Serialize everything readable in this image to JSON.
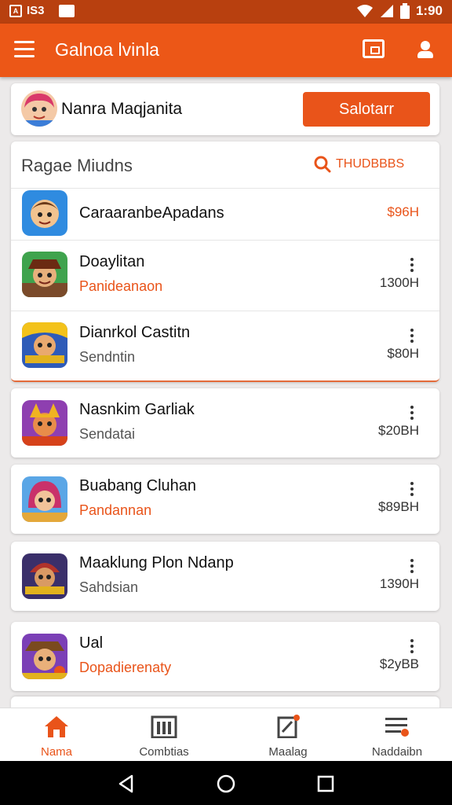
{
  "status_bar": {
    "left_label": "IS3",
    "time": "1:90"
  },
  "app_bar": {
    "title": "Galnoa lvinla"
  },
  "profile": {
    "name": "Nanra Maqjanita",
    "select_label": "Salotarr"
  },
  "list": {
    "title": "Ragae Miudns",
    "search_label": "THUDBBBS",
    "items": [
      {
        "name": "CaraaranbeApadans",
        "sub": "",
        "price": "$96H",
        "icon": "ninja-game-icon"
      },
      {
        "name": "Doaylitan",
        "sub": "Panideanaon",
        "price": "1300H",
        "icon": "pirate-game-icon"
      },
      {
        "name": "Dianrkol Castitn",
        "sub": "Sendntin",
        "price": "$80H",
        "icon": "warrior-game-icon"
      }
    ]
  },
  "cards": [
    {
      "name": "Nasnkim Garliak",
      "sub": "Sendatai",
      "price": "$20BH",
      "icon": "viking-game-icon"
    },
    {
      "name": "Buabang Cluhan",
      "sub": "Pandannan",
      "price": "$89BH",
      "icon": "mage-game-icon"
    },
    {
      "name": "Maaklung Plon Ndanp",
      "sub": "Sahdsian",
      "price": "1390H",
      "icon": "knight-game-icon"
    },
    {
      "name": "Ual",
      "sub": "Dopadierenaty",
      "price": "$2yBB",
      "icon": "cowboy-game-icon"
    }
  ],
  "bottom_nav": [
    {
      "label": "Nama",
      "icon": "home-icon"
    },
    {
      "label": "Combtias",
      "icon": "library-icon"
    },
    {
      "label": "Maalag",
      "icon": "edit-icon"
    },
    {
      "label": "Naddaibn",
      "icon": "menu-badge-icon"
    }
  ],
  "colors": {
    "accent": "#ec5717",
    "status_bar": "#b8400f",
    "background": "#eceaea"
  }
}
